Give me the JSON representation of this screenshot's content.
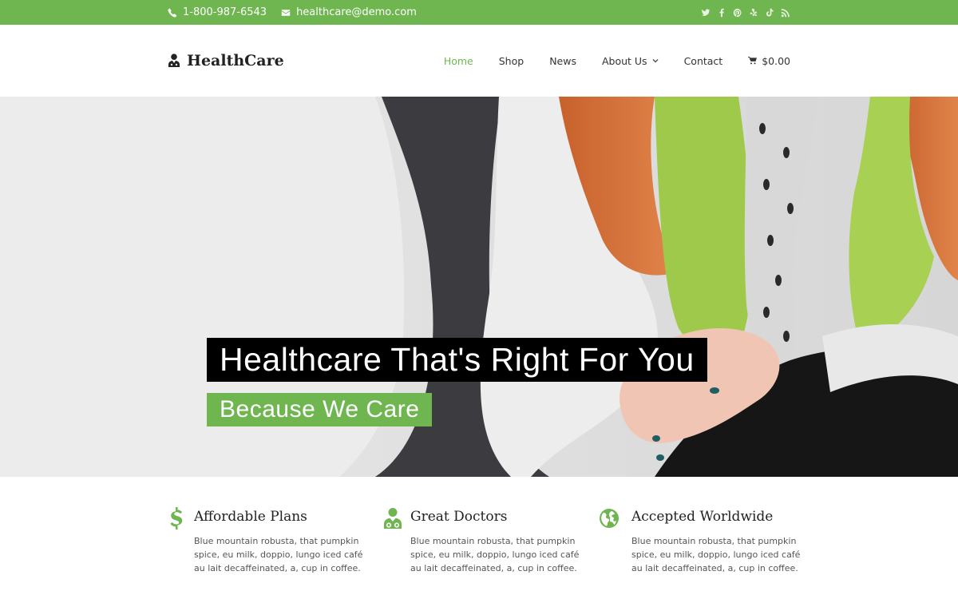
{
  "topbar": {
    "phone": "1-800-987-6543",
    "email": "healthcare@demo.com",
    "social_icons": [
      "twitter-icon",
      "facebook-icon",
      "pinterest-icon",
      "yelp-icon",
      "tiktok-icon",
      "rss-icon"
    ]
  },
  "header": {
    "logo_text": "HealthCare",
    "nav": [
      {
        "label": "Home",
        "active": true
      },
      {
        "label": "Shop"
      },
      {
        "label": "News"
      },
      {
        "label": "About Us",
        "dropdown": true
      },
      {
        "label": "Contact"
      }
    ],
    "cart_total": "$0.00"
  },
  "hero": {
    "title": "Healthcare That's Right For You",
    "subtitle": "Because We Care"
  },
  "features": [
    {
      "icon": "dollar-icon",
      "title": "Affordable Plans",
      "text": "Blue mountain robusta, that pumpkin spice, eu milk, doppio, lungo iced café au lait decaffeinated, a, cup in coffee."
    },
    {
      "icon": "doctor-icon",
      "title": "Great Doctors",
      "text": "Blue mountain robusta, that pumpkin spice, eu milk, doppio, lungo iced café au lait decaffeinated, a, cup in coffee."
    },
    {
      "icon": "globe-icon",
      "title": "Accepted Worldwide",
      "text": "Blue mountain robusta, that pumpkin spice, eu milk, doppio, lungo iced café au lait decaffeinated, a, cup in coffee."
    }
  ],
  "colors": {
    "brand_green": "#6fb650",
    "hero_title_bg": "#000000",
    "text_dark": "#222222"
  }
}
